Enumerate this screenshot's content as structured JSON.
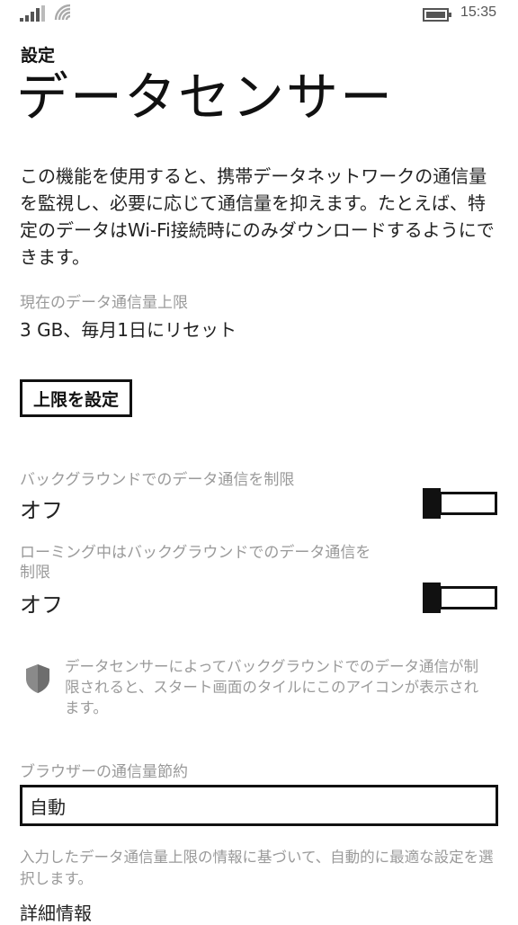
{
  "status_bar": {
    "time": "15:35",
    "icons": [
      "signal-icon",
      "wifi-icon",
      "battery-icon"
    ]
  },
  "header": {
    "breadcrumb": "設定",
    "title": "データセンサー"
  },
  "description": "この機能を使用すると、携帯データネットワークの通信量を監視し、必要に応じて通信量を抑えます。たとえば、特定のデータはWi-Fi接続時にのみダウンロードするようにできます。",
  "data_limit": {
    "label": "現在のデータ通信量上限",
    "value": "3 GB、毎月1日にリセット",
    "button_label": "上限を設定"
  },
  "background_restrict": {
    "label": "バックグラウンドでのデータ通信を制限",
    "value": "オフ",
    "state": false
  },
  "roaming_restrict": {
    "label": "ローミング中はバックグラウンドでのデータ通信を制限",
    "value": "オフ",
    "state": false
  },
  "info": {
    "icon": "shield-icon",
    "text": "データセンサーによってバックグラウンドでのデータ通信が制限されると、スタート画面のタイルにこのアイコンが表示されます。"
  },
  "browser_saving": {
    "label": "ブラウザーの通信量節約",
    "selected": "自動",
    "help": "入力したデータ通信量上限の情報に基づいて、自動的に最適な設定を選択します。"
  },
  "details_link": "詳細情報",
  "colors": {
    "text": "#111111",
    "muted": "#9a9a9a",
    "background": "#ffffff"
  }
}
